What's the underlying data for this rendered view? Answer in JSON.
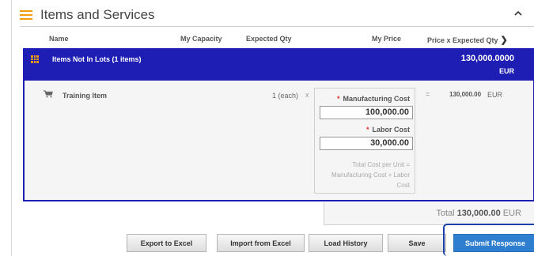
{
  "section": {
    "title": "Items and Services",
    "icon": "list-icon",
    "collapse_icon": "chevron-up-icon"
  },
  "columns": {
    "name": "Name",
    "my_capacity": "My Capacity",
    "expected_qty": "Expected Qty",
    "my_price": "My Price",
    "price_x_expected_qty": "Price x Expected Qty",
    "more_icon": "chevron-right-icon"
  },
  "lot": {
    "title": "Items Not In Lots (1 items)",
    "amount": "130,000.0000",
    "currency": "EUR",
    "icon": "grid-icon"
  },
  "item": {
    "name": "Training Item",
    "icon": "cart-icon",
    "qty": "1 (each)",
    "times": "x",
    "equals": "=",
    "total": "130,000.00",
    "currency": "EUR",
    "cost_fields": [
      {
        "label": "Manufacturing Cost",
        "required_mark": "*",
        "value": "100,000.00"
      },
      {
        "label": "Labor Cost",
        "required_mark": "*",
        "value": "30,000.00"
      }
    ],
    "formula": "Total Cost per Unit = Manufacturing Cost + Labor Cost"
  },
  "total": {
    "label": "Total",
    "amount": "130,000.00",
    "currency": "EUR"
  },
  "buttons": {
    "export": "Export to Excel",
    "import": "Import from Excel",
    "history": "Load History",
    "save": "Save",
    "submit": "Submit Response"
  },
  "colors": {
    "lot_bar": "#1e1eb4",
    "accent_icon": "#f39c12",
    "submit_button": "#2f7fd1",
    "required": "#dd3333"
  }
}
